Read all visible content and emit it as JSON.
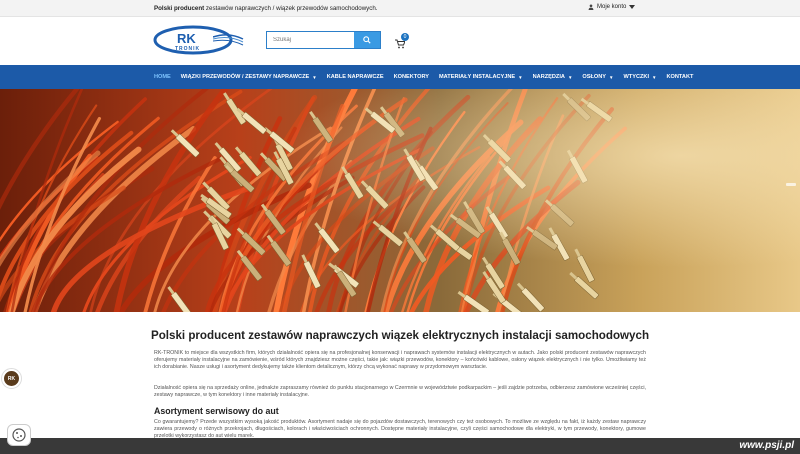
{
  "topbar": {
    "tagline_bold": "Polski producent",
    "tagline_rest": " zestawów naprawczych / wiązek przewodów samochodowych.",
    "account_label": "Moje konto",
    "account_icon": "user-icon"
  },
  "header": {
    "logo_text_top": "RK",
    "logo_text_bottom": "TRONIK",
    "search": {
      "placeholder": "Szukaj"
    },
    "cart": {
      "count": "0"
    }
  },
  "nav": {
    "items": [
      {
        "label": "HOME",
        "active": true,
        "dropdown": false
      },
      {
        "label": "WIĄZKI PRZEWODÓW / ZESTAWY NAPRAWCZE",
        "active": false,
        "dropdown": true
      },
      {
        "label": "KABLE NAPRAWCZE",
        "active": false,
        "dropdown": false
      },
      {
        "label": "KONEKTORY",
        "active": false,
        "dropdown": false
      },
      {
        "label": "MATERIAŁY INSTALACYJNE",
        "active": false,
        "dropdown": true
      },
      {
        "label": "NARZĘDZIA",
        "active": false,
        "dropdown": true
      },
      {
        "label": "OSŁONY",
        "active": false,
        "dropdown": true
      },
      {
        "label": "WTYCZKI",
        "active": false,
        "dropdown": true
      },
      {
        "label": "KONTAKT",
        "active": false,
        "dropdown": false
      }
    ]
  },
  "content": {
    "title": "Polski producent zestawów naprawczych wiązek elektrycznych instalacji samochodowych",
    "para1": "RK-TRONIK to miejsce dla wszystkich firm, których działalność opiera się na profesjonalnej konserwacji i naprawach systemów instalacji elektrycznych w autach. Jako polski producent zestawów naprawczych oferujemy materiały instalacyjne na zamówienie, wśród których znajdziesz możne części, takie jak: wiązki przewodów, konektory – końcówki kablowe, osłony wiązek elektrycznych i nie tylko. Umożliwiamy też ich dorabianie. Nasze usługi i asortyment dedykujemy także klientom detalicznym, którzy chcą wykonać naprawy w przydomowym warsztacie.",
    "para2": "Działalność opiera się na sprzedaży online, jednakże zapraszamy również do punktu stacjonarnego w Czermnie w województwie podkarpackim – jeśli zajdzie potrzeba, odbierzesz zamówione wcześniej części, zestawy naprawcze, w tym konektory i inne materiały instalacyjne.",
    "subheading": "Asortyment serwisowy do aut",
    "para3": "Co gwarantujemy? Przede wszystkim wysoką jakość produktów. Asortyment nadaje się do pojazdów dostawczych, terenowych czy też osobowych. To możliwe ze względu na fakt, iż każdy zestaw naprawczy zawiera przewody o różnych przekrojach, długościach, kolorach i właściwościach ochronnych. Dostępne materiały instalacyjne, czyli części samochodowe dla elektryki, w tym przewody, konektory, gumowe przelotki wykorzystasz do aut wielu marek."
  },
  "widgets": {
    "side_badge": "RK",
    "cookie_icon": "cookie-icon"
  },
  "watermark": "www.psji.pl",
  "colors": {
    "nav_bg": "#1c5aa8",
    "accent": "#3a9ae3",
    "active_nav": "#7dc3ff"
  }
}
